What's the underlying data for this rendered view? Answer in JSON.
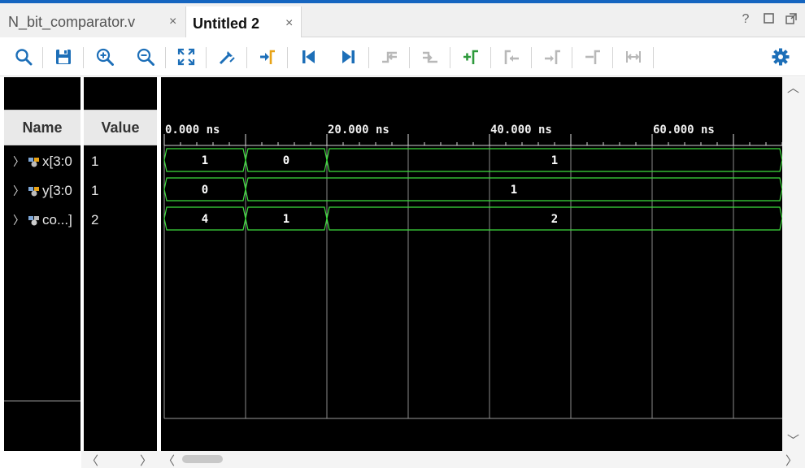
{
  "tabs": [
    {
      "label": "N_bit_comparator.v",
      "close": "×",
      "active": false
    },
    {
      "label": "Untitled 2",
      "close": "×",
      "active": true
    }
  ],
  "window_buttons": [
    "?",
    "□",
    "⧉"
  ],
  "toolbar": {
    "icons": [
      "search-icon",
      "save-icon",
      "zoom-in-icon",
      "zoom-out-icon",
      "zoom-fit-icon",
      "cursor-icon",
      "go-to-cursor-icon",
      "go-to-start-icon",
      "go-to-end-icon",
      "previous-transition-icon",
      "next-transition-icon",
      "add-marker-icon",
      "previous-marker-icon",
      "next-marker-icon",
      "swap-cursors-icon",
      "snap-to-transition-icon",
      "settings-icon"
    ]
  },
  "columns": {
    "name": "Name",
    "value": "Value"
  },
  "signals": [
    {
      "name": "x[3:0",
      "value": "1",
      "segments": [
        {
          "from": 0,
          "to": 10,
          "label": "1"
        },
        {
          "from": 10,
          "to": 20,
          "label": "0"
        },
        {
          "from": 20,
          "to": 76,
          "label": "1"
        }
      ]
    },
    {
      "name": "y[3:0",
      "value": "1",
      "segments": [
        {
          "from": 0,
          "to": 10,
          "label": "0"
        },
        {
          "from": 10,
          "to": 76,
          "label": "1"
        }
      ]
    },
    {
      "name": "co...]",
      "value": "2",
      "segments": [
        {
          "from": 0,
          "to": 10,
          "label": "4"
        },
        {
          "from": 10,
          "to": 20,
          "label": "1"
        },
        {
          "from": 20,
          "to": 76,
          "label": "2"
        }
      ]
    }
  ],
  "time_axis": {
    "unit": "ns",
    "labels": [
      "0.000 ns",
      "20.000 ns",
      "40.000 ns",
      "60.000 ns"
    ],
    "label_values": [
      0,
      20,
      40,
      60
    ],
    "gridlines": [
      10,
      20,
      30,
      40,
      50,
      60,
      70
    ],
    "range": [
      0,
      76
    ]
  },
  "colors": {
    "wave": "#3cdc3c",
    "background": "#000000",
    "grid": "#8a8a8a",
    "accent": "#1565c0"
  }
}
